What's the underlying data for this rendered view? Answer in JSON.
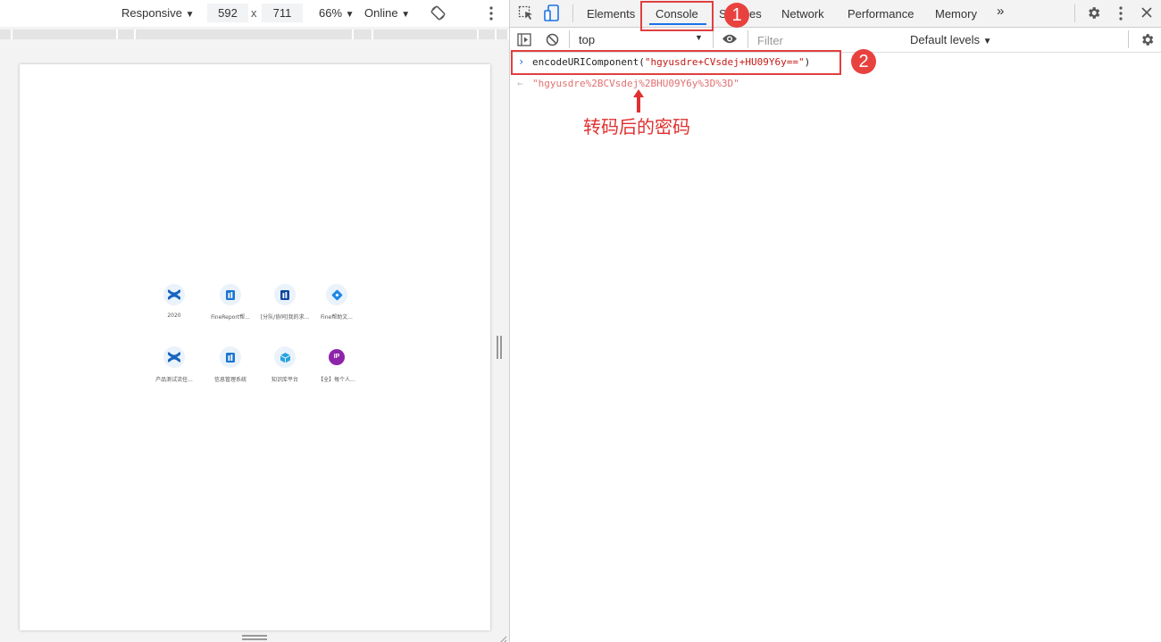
{
  "device_toolbar": {
    "mode": "Responsive",
    "width": "592",
    "times": "x",
    "height": "711",
    "zoom": "66%",
    "network": "Online"
  },
  "apps": [
    {
      "label": "2020",
      "icon": "confluence-icon",
      "color": "#1565c0"
    },
    {
      "label": "FineReport帮...",
      "icon": "finereport-icon",
      "color": "#1976d2"
    },
    {
      "label": "[分队/协同]我的求...",
      "icon": "finereport-icon",
      "color": "#0d47a1"
    },
    {
      "label": "Fine帮助文...",
      "icon": "fine-doc-icon",
      "color": "#1e88e5"
    },
    {
      "label": "产品测试流任...",
      "icon": "confluence-icon",
      "color": "#1565c0"
    },
    {
      "label": "信息管理系统",
      "icon": "finereport-icon",
      "color": "#1976d2"
    },
    {
      "label": "知识库平台",
      "icon": "cube-icon",
      "color": "#29a3e0"
    },
    {
      "label": "【全】每个人...",
      "icon": "ip-icon",
      "color": "#8e24aa",
      "text": "IP"
    }
  ],
  "devtools": {
    "tabs": [
      "Elements",
      "Console",
      "Sources",
      "Network",
      "Performance",
      "Memory"
    ],
    "active_tab": "Console",
    "context": "top",
    "filter_placeholder": "Filter",
    "levels": "Default levels"
  },
  "console": {
    "input_fn": "encodeURIComponent(",
    "input_arg": "\"hgyusdre+CVsdej+HU09Y6y==\"",
    "input_close": ")",
    "output": "\"hgyusdre%2BCVsdej%2BHU09Y6y%3D%3D\""
  },
  "annotations": {
    "badge1": "1",
    "badge2": "2",
    "arrow_caption": "转码后的密码"
  },
  "colors": {
    "accent": "#1a73e8",
    "annotation_red": "#e04040",
    "string_red": "#c41a16",
    "output_red": "#e07070"
  }
}
